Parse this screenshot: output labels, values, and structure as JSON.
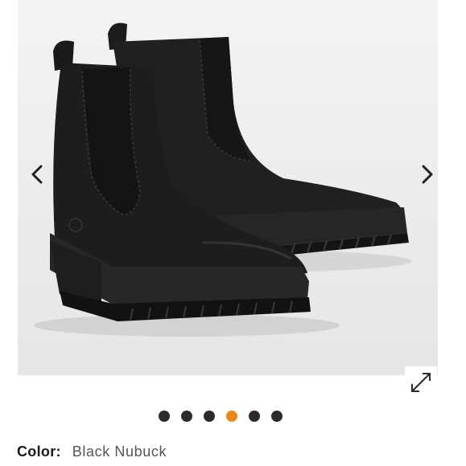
{
  "gallery": {
    "image_subject": "black-chelsea-boots",
    "prev_icon": "chevron-left-icon",
    "next_icon": "chevron-right-icon",
    "expand_icon": "expand-icon",
    "dot_count": 6,
    "active_dot_index": 3,
    "dot_color": "#2b2b2b",
    "active_dot_color": "#e8891d"
  },
  "product": {
    "color_label": "Color:",
    "color_value": "Black Nubuck"
  }
}
